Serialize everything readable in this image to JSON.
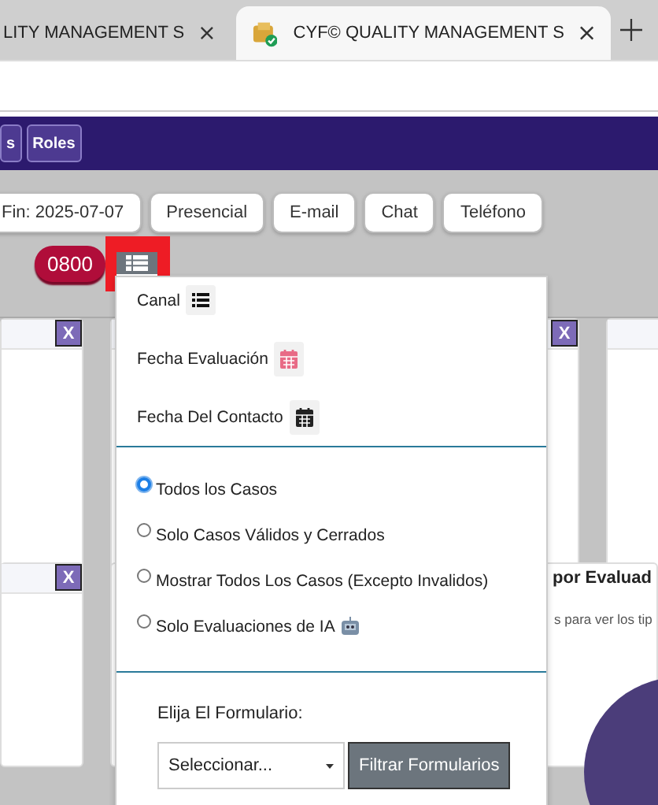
{
  "browser": {
    "tabs": [
      {
        "title": "LITY MANAGEMENT S",
        "selected": false
      },
      {
        "title": "CYF© QUALITY MANAGEMENT S",
        "selected": true
      }
    ]
  },
  "nav": {
    "buttons": [
      "s",
      "Roles"
    ]
  },
  "filters": [
    "Fin: 2025-07-07",
    "Presencial",
    "E-mail",
    "Chat",
    "Teléfono"
  ],
  "badge": "0800",
  "cards": [
    {
      "close": "X"
    },
    {
      "close": "X"
    },
    {
      "close": "X"
    },
    {
      "title": "por Evaluad",
      "text": "s para ver los tip"
    }
  ],
  "dropdown": {
    "sort_options": [
      {
        "label": "Canal",
        "kind": "list",
        "color": "#111111"
      },
      {
        "label": "Fecha Evaluación",
        "kind": "calendar",
        "color": "#e86b86"
      },
      {
        "label": "Fecha Del Contacto",
        "kind": "calendar",
        "color": "#222222"
      }
    ],
    "case_filters": [
      {
        "label": "Todos los Casos",
        "selected": true,
        "kind": "plain"
      },
      {
        "label": "Solo Casos Válidos y Cerrados",
        "selected": false,
        "kind": "plain"
      },
      {
        "label": "Mostrar Todos Los Casos (Excepto Invalidos)",
        "selected": false,
        "kind": "plain"
      },
      {
        "label": "Solo Evaluaciones de IA",
        "selected": false,
        "kind": "ai"
      }
    ],
    "form_label": "Elija El Formulario:",
    "form_select": {
      "value": "Seleccionar..."
    },
    "filter_button": "Filtrar Formularios"
  }
}
